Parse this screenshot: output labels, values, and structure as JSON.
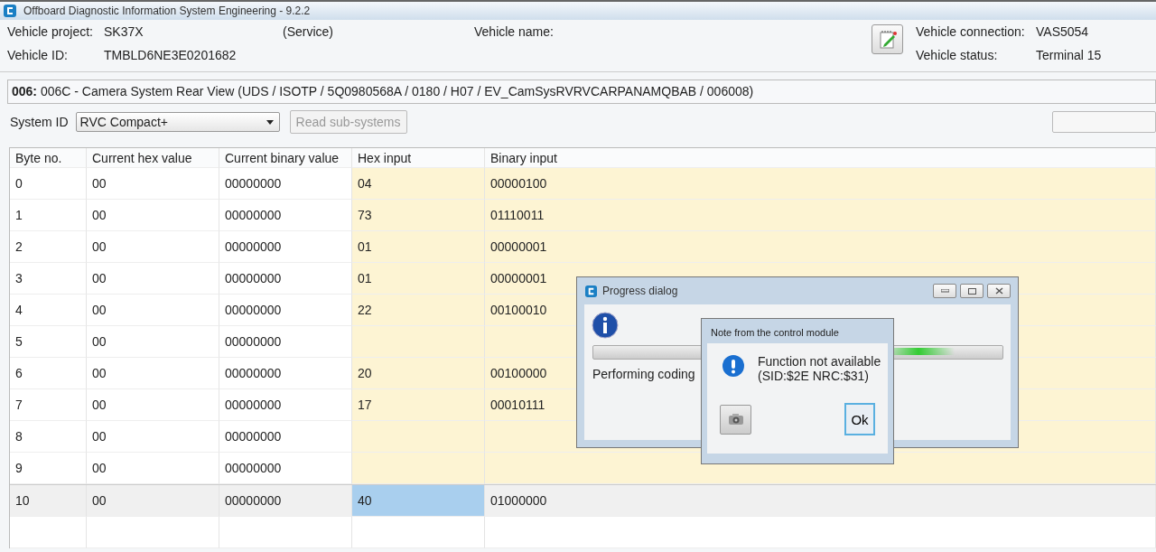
{
  "window": {
    "title": "Offboard Diagnostic Information System Engineering - 9.2.2"
  },
  "vehicle": {
    "project_label": "Vehicle project:",
    "project": "SK37X",
    "mode": "(Service)",
    "name_label": "Vehicle name:",
    "id_label": "Vehicle ID:",
    "id": "TMBLD6NE3E0201682",
    "connection_label": "Vehicle connection:",
    "connection": "VAS5054",
    "status_label": "Vehicle status:",
    "status": "Terminal 15"
  },
  "module": {
    "address": "006:",
    "description": "006C - Camera System Rear View  (UDS / ISOTP / 5Q0980568A / 0180 / H07 / EV_CamSysRVRVCARPANAMQBAB / 006008)"
  },
  "system_id": {
    "label": "System ID",
    "value": "RVC Compact+",
    "button": "Read sub-systems",
    "button_disabled": true
  },
  "table": {
    "columns": [
      "Byte no.",
      "Current hex value",
      "Current binary value",
      "Hex input",
      "Binary input"
    ],
    "rows": [
      {
        "byte": "0",
        "current_hex": "00",
        "current_binary": "00000000",
        "hex_input": "04",
        "binary_input": "00000100",
        "selected": false
      },
      {
        "byte": "1",
        "current_hex": "00",
        "current_binary": "00000000",
        "hex_input": "73",
        "binary_input": "01110011",
        "selected": false
      },
      {
        "byte": "2",
        "current_hex": "00",
        "current_binary": "00000000",
        "hex_input": "01",
        "binary_input": "00000001",
        "selected": false
      },
      {
        "byte": "3",
        "current_hex": "00",
        "current_binary": "00000000",
        "hex_input": "01",
        "binary_input": "00000001",
        "selected": false
      },
      {
        "byte": "4",
        "current_hex": "00",
        "current_binary": "00000000",
        "hex_input": "22",
        "binary_input": "00100010",
        "selected": false
      },
      {
        "byte": "5",
        "current_hex": "00",
        "current_binary": "00000000",
        "selected": false
      },
      {
        "byte": "6",
        "current_hex": "00",
        "current_binary": "00000000",
        "hex_input": "20",
        "binary_input": "00100000",
        "selected": false
      },
      {
        "byte": "7",
        "current_hex": "00",
        "current_binary": "00000000",
        "hex_input": "17",
        "binary_input": "00010111",
        "selected": false
      },
      {
        "byte": "8",
        "current_hex": "00",
        "current_binary": "00000000",
        "selected": false
      },
      {
        "byte": "9",
        "current_hex": "00",
        "current_binary": "00000000",
        "selected": false
      },
      {
        "byte": "10",
        "current_hex": "00",
        "current_binary": "00000000",
        "hex_input": "40",
        "binary_input": "01000000",
        "selected": true
      }
    ]
  },
  "progress_dialog": {
    "title": "Progress dialog",
    "message": "Performing coding"
  },
  "note_dialog": {
    "title": "Note from the control module",
    "message_line1": "Function not available",
    "message_line2": "(SID:$2E NRC:$31)",
    "ok_button": "Ok"
  }
}
